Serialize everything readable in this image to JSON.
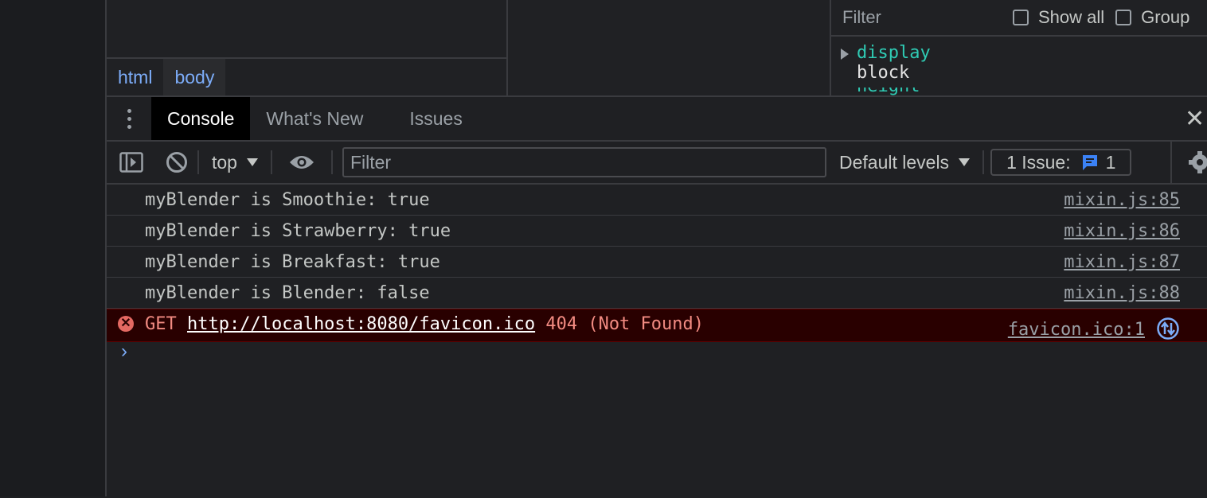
{
  "elements": {
    "breadcrumbs": [
      "html",
      "body"
    ]
  },
  "computed": {
    "filter_placeholder": "Filter",
    "show_all_label": "Show all",
    "group_label": "Group",
    "property_name": "display",
    "property_value": "block",
    "next_property_partial": "height"
  },
  "drawer": {
    "tabs": [
      "Console",
      "What's New",
      "Issues"
    ],
    "active_tab": "Console",
    "close_glyph": "✕"
  },
  "toolbar": {
    "context": "top",
    "filter_placeholder": "Filter",
    "levels": "Default levels",
    "issues_label": "1 Issue:",
    "issues_count": "1"
  },
  "messages": [
    {
      "text": "myBlender is Smoothie: true",
      "source": "mixin.js:85"
    },
    {
      "text": "myBlender is Strawberry: true",
      "source": "mixin.js:86"
    },
    {
      "text": "myBlender is Breakfast: true",
      "source": "mixin.js:87"
    },
    {
      "text": "myBlender is Blender: false",
      "source": "mixin.js:88"
    }
  ],
  "error": {
    "method": "GET",
    "url": "http://localhost:8080/favicon.ico",
    "status": "404 (Not Found)",
    "source": "favicon.ico:1"
  },
  "prompt_glyph": "›",
  "colors": {
    "accent_blue": "#7cacf8",
    "error_text": "#f28b82",
    "error_bg": "#290000",
    "property_teal": "#2fcbb4"
  }
}
